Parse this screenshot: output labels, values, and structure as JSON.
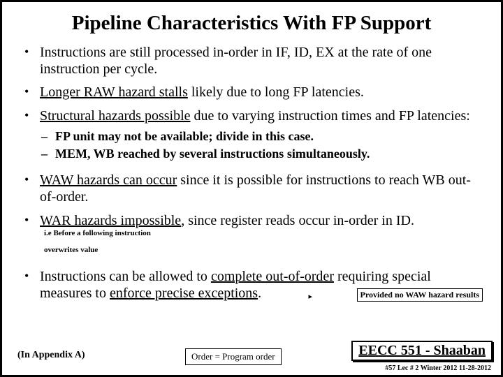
{
  "title": "Pipeline Characteristics With FP Support",
  "b1": "Instructions are still processed in-order in IF, ID, EX at the rate of one instruction per cycle.",
  "b2a": "Longer RAW hazard stalls",
  "b2b": " likely due to long FP latencies.",
  "b3a": "Structural hazards possible",
  "b3b": " due to varying instruction times and FP latencies:",
  "s1": "FP unit may not be available; divide in this case.",
  "s2": "MEM, WB reached by several instructions simultaneously.",
  "b4a": "WAW hazards can occur",
  "b4b": " since it is possible for instructions to reach WB out-of-order.",
  "b5a": "WAR hazards impossible",
  "b5b": ", since register reads occur in-order in ID.",
  "inlineNote1": "i.e Before a following instruction",
  "inlineNote2": "overwrites value",
  "noteBox": "Provided no WAW hazard results",
  "b6a": "Instructions can be allowed to ",
  "b6b": "complete out-of-order",
  "b6c": " requiring special measures to ",
  "b6d": "enforce precise exceptions",
  "b6e": ".",
  "orderBox": "Order = Program order",
  "appendix": "(In  Appendix A)",
  "course": "EECC 551 - Shaaban",
  "meta": "#57   Lec # 2   Winter 2012   11-28-2012"
}
